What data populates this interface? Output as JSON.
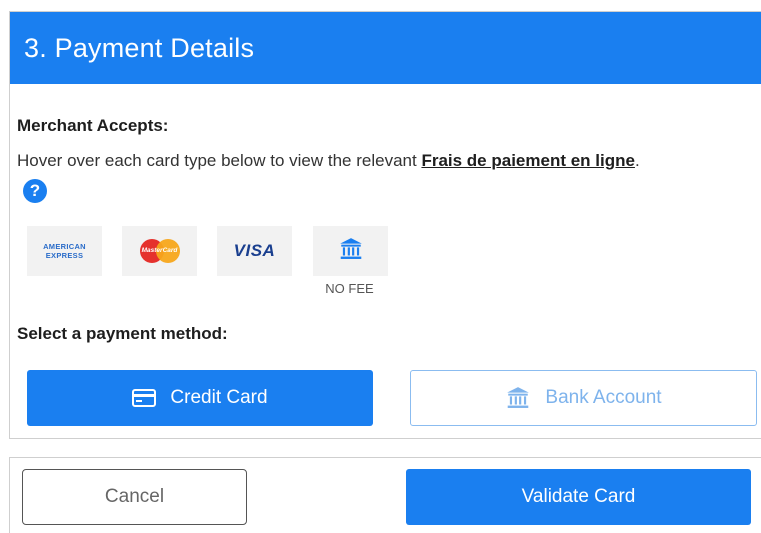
{
  "section": {
    "title": "3. Payment Details"
  },
  "merchant": {
    "accepts_label": "Merchant Accepts:",
    "hover_text": "Hover over each card type below to view the relevant ",
    "fee_link": "Frais de paiement en ligne",
    "hover_suffix": ".",
    "help_icon_glyph": "?"
  },
  "cards": [
    {
      "name": "amex-card",
      "line1": "AMERICAN",
      "line2": "EXPRESS"
    },
    {
      "name": "mastercard-card",
      "text": "MasterCard"
    },
    {
      "name": "visa-card",
      "text": "VISA"
    },
    {
      "name": "bank-card",
      "icon": "bank-icon",
      "fee_note": "NO FEE"
    }
  ],
  "payment_method": {
    "label": "Select a payment method:",
    "credit_card_label": "Credit Card",
    "credit_card_icon": "credit-card-icon",
    "bank_account_label": "Bank Account",
    "bank_account_icon": "bank-icon"
  },
  "footer": {
    "cancel_label": "Cancel",
    "validate_label": "Validate Card"
  },
  "colors": {
    "accent": "#1a7ff0",
    "disabled_text": "#7eb3ec"
  }
}
